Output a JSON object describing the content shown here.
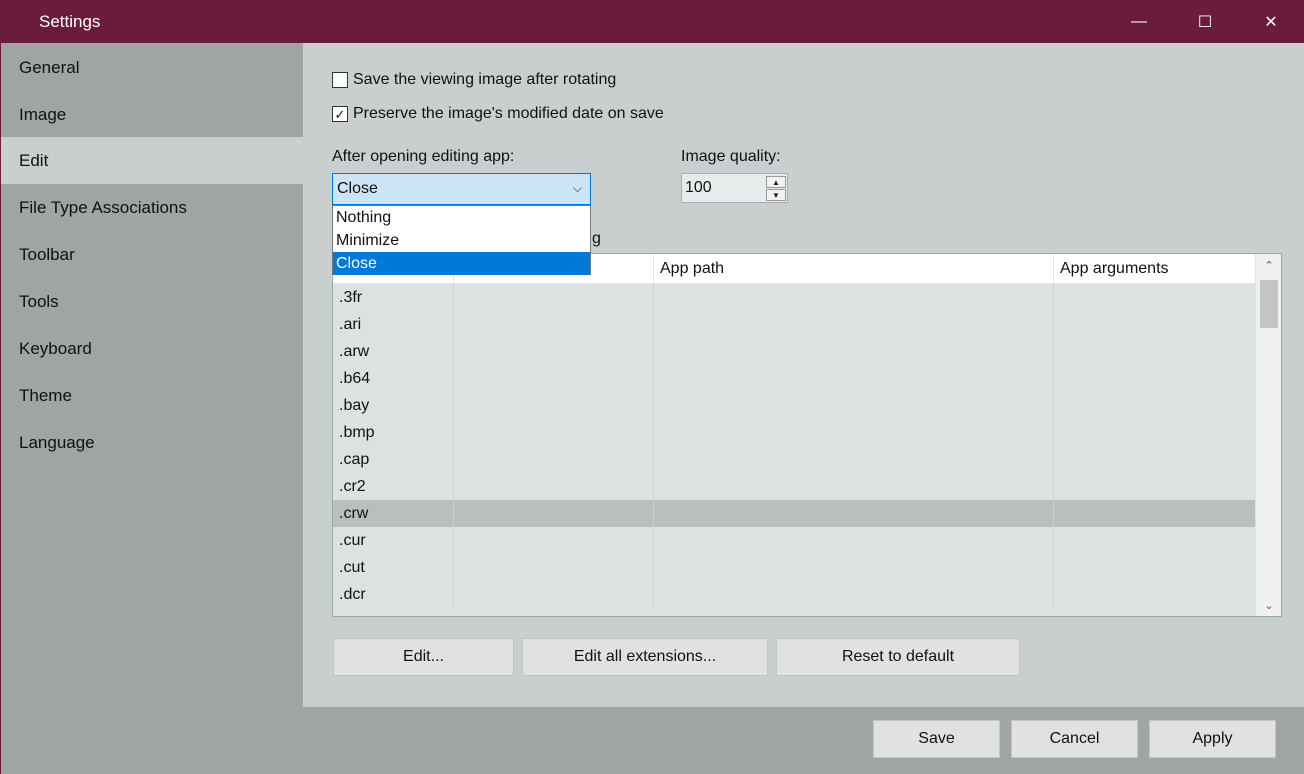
{
  "window": {
    "title": "Settings",
    "minimize_glyph": "—",
    "maximize_glyph": "☐",
    "close_glyph": "✕"
  },
  "sidebar": {
    "items": [
      {
        "label": "General"
      },
      {
        "label": "Image"
      },
      {
        "label": "Edit"
      },
      {
        "label": "File Type Associations"
      },
      {
        "label": "Toolbar"
      },
      {
        "label": "Tools"
      },
      {
        "label": "Keyboard"
      },
      {
        "label": "Theme"
      },
      {
        "label": "Language"
      }
    ],
    "active_index": 2
  },
  "edit": {
    "save_after_rotating": {
      "label": "Save the viewing image after rotating",
      "checked": false
    },
    "preserve_modified_date": {
      "label": "Preserve the image's modified date on save",
      "checked": true,
      "check_glyph": "✓"
    },
    "after_opening_label": "After opening editing app:",
    "after_opening_value": "Close",
    "after_opening_options": [
      "Nothing",
      "Minimize",
      "Close"
    ],
    "image_quality_label": "Image quality:",
    "image_quality_value": "100",
    "list_label_visible_fragment": "g",
    "table": {
      "columns": [
        "",
        "App path",
        "App arguments"
      ],
      "rows": [
        ".3fr",
        ".ari",
        ".arw",
        ".b64",
        ".bay",
        ".bmp",
        ".cap",
        ".cr2",
        ".crw",
        ".cur",
        ".cut",
        ".dcr"
      ],
      "highlighted_row": ".crw"
    },
    "buttons": {
      "edit": "Edit...",
      "edit_all": "Edit all extensions...",
      "reset": "Reset to default"
    }
  },
  "footer": {
    "save": "Save",
    "cancel": "Cancel",
    "apply": "Apply"
  },
  "colors": {
    "titlebar": "#6a1c3a",
    "sidebar": "#9fa4a4",
    "content": "#c8cfce",
    "selection": "#0078d7"
  }
}
